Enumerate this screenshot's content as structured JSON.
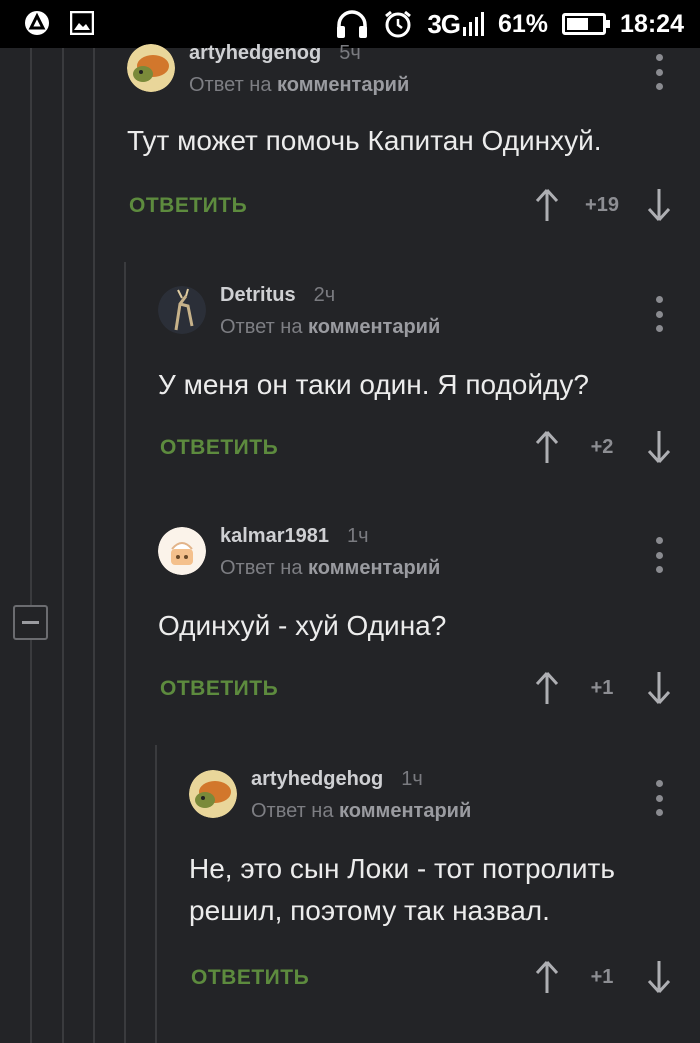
{
  "status_bar": {
    "network": "3G",
    "battery_percent": "61%",
    "battery_level": 0.61,
    "time": "18:24",
    "icons": [
      "app-icon",
      "image-icon",
      "headphones-icon",
      "alarm-icon",
      "signal-icon",
      "battery-icon"
    ]
  },
  "collapse_label": "−",
  "comments": [
    {
      "username": "artyhedgenog",
      "time": "5ч",
      "reply_prefix": "Ответ на",
      "reply_link": "комментарий",
      "text": "Тут может помочь Капитан Одинхуй.",
      "reply_label": "ОТВЕТИТЬ",
      "rating": "+19"
    },
    {
      "username": "Detritus",
      "time": "2ч",
      "reply_prefix": "Ответ на",
      "reply_link": "комментарий",
      "text": "У меня он таки один. Я подойду?",
      "reply_label": "ОТВЕТИТЬ",
      "rating": "+2"
    },
    {
      "username": "kalmar1981",
      "time": "1ч",
      "reply_prefix": "Ответ на",
      "reply_link": "комментарий",
      "text": "Одинхуй - хуй Одина?",
      "reply_label": "ОТВЕТИТЬ",
      "rating": "+1"
    },
    {
      "username": "artyhedgehog",
      "time": "1ч",
      "reply_prefix": "Ответ на",
      "reply_link": "комментарий",
      "text_line1": "Не, это сын Локи - тот потролить",
      "text_line2": "решил, поэтому так назвал.",
      "reply_label": "ОТВЕТИТЬ",
      "rating": "+1"
    }
  ],
  "colors": {
    "background": "#232427",
    "reply_green": "#5d8b3e",
    "muted": "#7d7e83"
  }
}
